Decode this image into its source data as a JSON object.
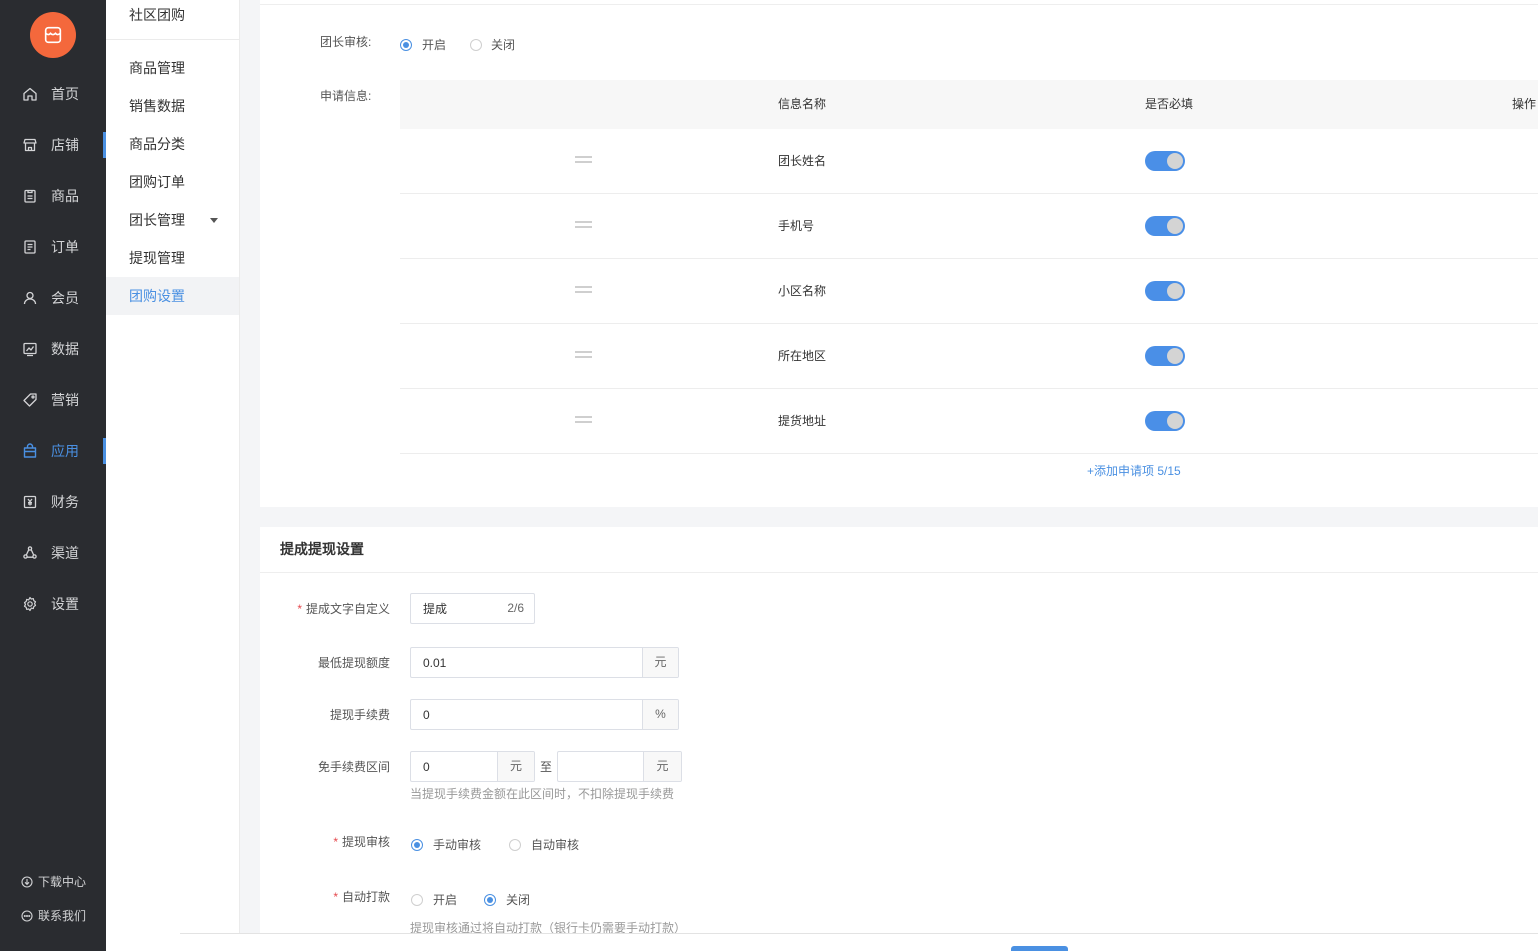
{
  "sidebar": {
    "logo": {
      "icon": "store-logo-icon",
      "color": "#f4683c"
    },
    "items": [
      {
        "label": "首页",
        "icon": "home-icon"
      },
      {
        "label": "店铺",
        "icon": "shop-icon",
        "highlighted": true
      },
      {
        "label": "商品",
        "icon": "goods-icon"
      },
      {
        "label": "订单",
        "icon": "order-icon"
      },
      {
        "label": "会员",
        "icon": "member-icon"
      },
      {
        "label": "数据",
        "icon": "data-chart-icon"
      },
      {
        "label": "营销",
        "icon": "tag-icon"
      },
      {
        "label": "应用",
        "icon": "app-bag-icon",
        "active": true,
        "highlighted": true
      },
      {
        "label": "财务",
        "icon": "finance-icon"
      },
      {
        "label": "渠道",
        "icon": "channel-icon"
      },
      {
        "label": "设置",
        "icon": "gear-icon"
      }
    ],
    "footer": [
      {
        "label": "下载中心",
        "icon": "download-icon"
      },
      {
        "label": "联系我们",
        "icon": "chat-icon"
      }
    ]
  },
  "subnav": {
    "title": "社区团购",
    "items": [
      {
        "label": "商品管理"
      },
      {
        "label": "销售数据"
      },
      {
        "label": "商品分类"
      },
      {
        "label": "团购订单"
      },
      {
        "label": "团长管理",
        "expandable": true
      },
      {
        "label": "提现管理"
      },
      {
        "label": "团购设置",
        "active": true
      }
    ]
  },
  "leader_audit": {
    "label": "团长审核:",
    "options": [
      "开启",
      "关闭"
    ],
    "selected_index": 0
  },
  "apply_info": {
    "label": "申请信息:",
    "columns": [
      "信息名称",
      "是否必填",
      "操作"
    ],
    "rows": [
      {
        "name": "团长姓名",
        "required": true
      },
      {
        "name": "手机号",
        "required": true
      },
      {
        "name": "小区名称",
        "required": true
      },
      {
        "name": "所在地区",
        "required": true
      },
      {
        "name": "提货地址",
        "required": true
      }
    ],
    "add_link": "+添加申请项 5/15"
  },
  "withdraw": {
    "title": "提成提现设置",
    "commission_text": {
      "label": "提成文字自定义",
      "required": true,
      "value": "提成",
      "counter": "2/6"
    },
    "min_amount": {
      "label": "最低提现额度",
      "value": "0.01",
      "unit": "元"
    },
    "fee": {
      "label": "提现手续费",
      "value": "0",
      "unit": "%"
    },
    "free_range": {
      "label": "免手续费区间",
      "from": "0",
      "from_unit": "元",
      "separator": "至",
      "to": "",
      "to_unit": "元",
      "hint": "当提现手续费金额在此区间时，不扣除提现手续费"
    },
    "audit": {
      "label": "提现审核",
      "required": true,
      "options": [
        "手动审核",
        "自动审核"
      ],
      "selected_index": 0
    },
    "auto_pay": {
      "label": "自动打款",
      "required": true,
      "options": [
        "开启",
        "关闭"
      ],
      "selected_index": 1,
      "hint": "提现审核通过将自动打款（银行卡仍需要手动打款）"
    }
  },
  "colors": {
    "accent": "#4a90e2",
    "sidebar_bg": "#2a2c30",
    "toggle_on": "#4a8fe7",
    "required_star": "#e5484d"
  }
}
